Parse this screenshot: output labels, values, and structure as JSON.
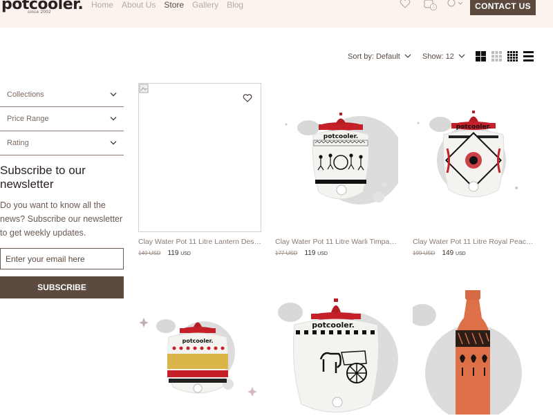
{
  "header": {
    "logo": "potcooler.",
    "logo_sub": "since 2002",
    "nav": [
      "Home",
      "About Us",
      "Store",
      "Gallery",
      "Blog"
    ],
    "active_nav": "Store",
    "contact_label": "CONTACT US",
    "cart_count": "0"
  },
  "toolbar": {
    "sort_label": "Sort by: Default",
    "show_label": "Show: 12"
  },
  "sidebar": {
    "filters": [
      "Collections",
      "Price Range",
      "Rating"
    ],
    "newsletter_title": "Subscribe to our newsletter",
    "newsletter_text": "Do you want to know all the news? Subscribe our newsletter to get weekly updates.",
    "email_placeholder": "Enter your email here",
    "subscribe_label": "SUBSCRIBE"
  },
  "products": [
    {
      "name": "Clay Water Pot 11 Litre Lantern Design",
      "old_price": "149 USD",
      "price": "119",
      "currency": "USD"
    },
    {
      "name": "Clay Water Pot 11 Litre Warli Timpany ...",
      "old_price": "177 USD",
      "price": "119",
      "currency": "USD"
    },
    {
      "name": "Clay Water Pot 11 Litre Royal Peacock...",
      "old_price": "199 USD",
      "price": "149",
      "currency": "USD"
    }
  ],
  "colors": {
    "accent": "#5b4a3d",
    "header_bg": "#fbf3ee"
  }
}
